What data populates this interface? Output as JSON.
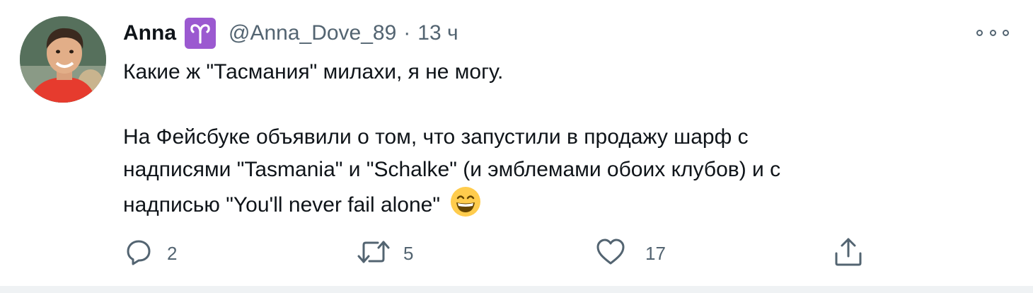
{
  "author": {
    "name": "Anna",
    "zodiac_glyph": "♈",
    "handle": "@Anna_Dove_89",
    "separator": "·",
    "time": "13 ч"
  },
  "tweet": {
    "line1": "Какие ж \"Тасмания\" милахи, я не могу.",
    "line2": "На Фейсбуке объявили о том, что запустили в продажу шарф с",
    "line3": "надписями \"Tasmania\" и \"Schalke\" (и эмблемами обоих клубов) и с",
    "line4": "надписью \"You'll never fail alone\"",
    "emoji": "grinning-face-emoji"
  },
  "actions": {
    "reply_count": "2",
    "retweet_count": "5",
    "like_count": "17"
  },
  "colors": {
    "secondary_text": "#536471",
    "primary_text": "#0f1419",
    "zodiac_badge": "#9b59d0"
  },
  "icons": [
    "more-icon",
    "reply-icon",
    "retweet-icon",
    "like-icon",
    "share-icon"
  ]
}
